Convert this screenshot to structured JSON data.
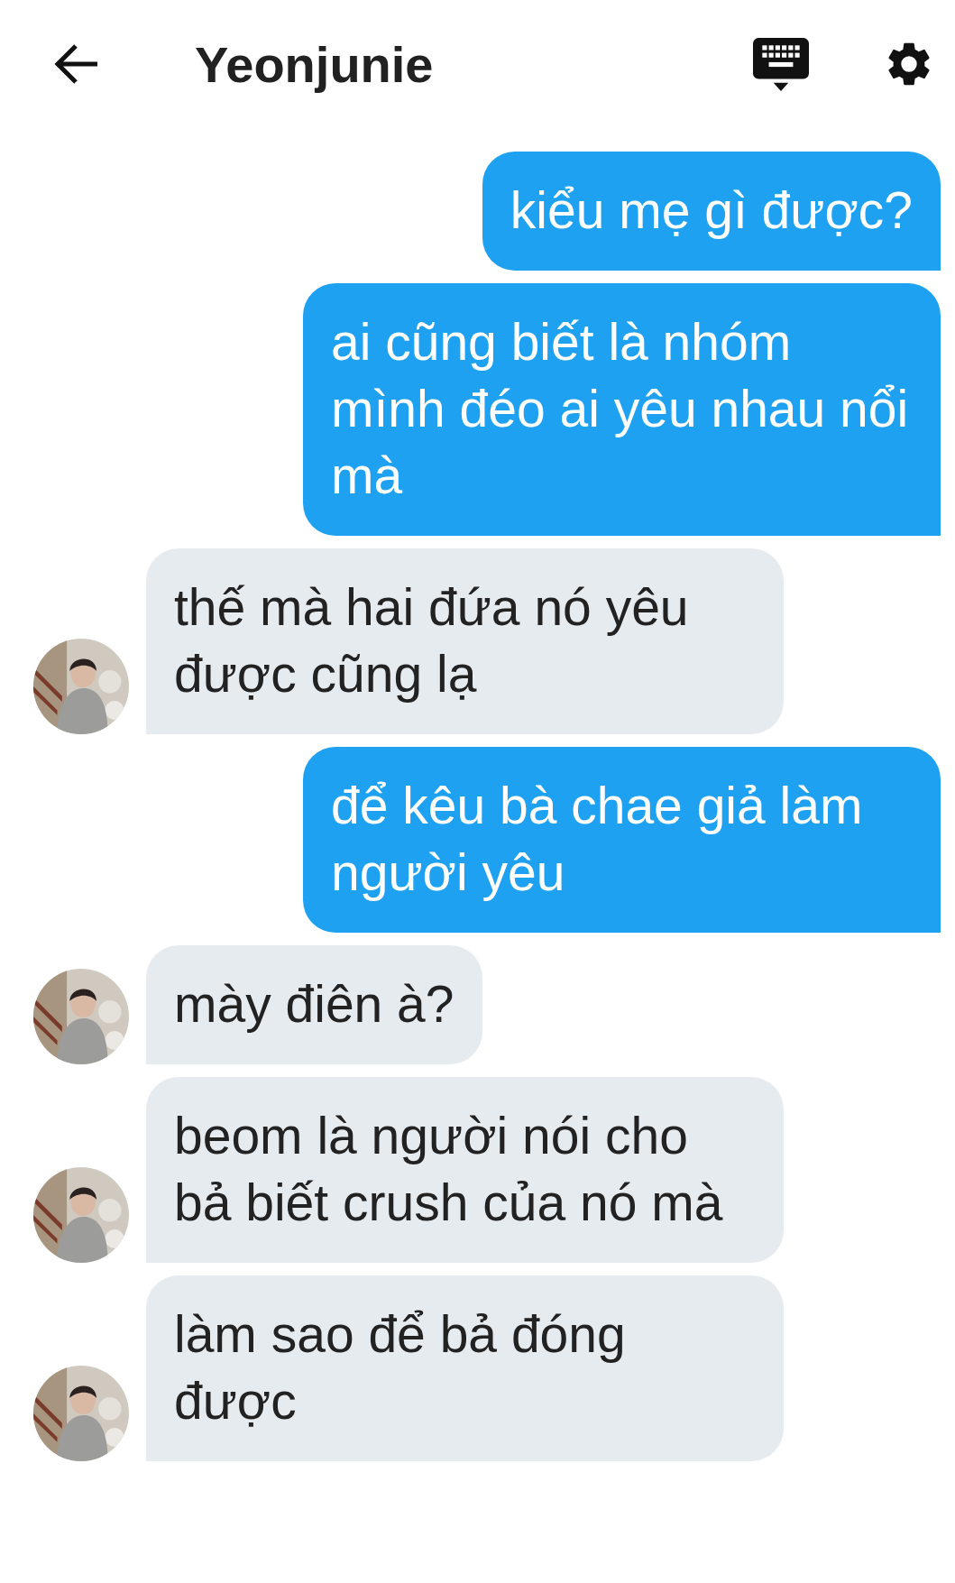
{
  "header": {
    "title": "Yeonjunie"
  },
  "messages": [
    {
      "kind": "sent",
      "text": "kiểu mẹ gì được?"
    },
    {
      "kind": "sent",
      "text": "ai cũng biết là nhóm mình đéo ai yêu nhau nổi mà"
    },
    {
      "kind": "received",
      "text": "thế mà hai đứa nó yêu được cũng lạ"
    },
    {
      "kind": "sent",
      "text": "để kêu bà chae giả làm người yêu"
    },
    {
      "kind": "received",
      "text": "mày điên à?"
    },
    {
      "kind": "received",
      "text": "beom là người nói cho bả biết crush của nó mà"
    },
    {
      "kind": "received",
      "text": "làm sao để bả đóng được"
    }
  ]
}
